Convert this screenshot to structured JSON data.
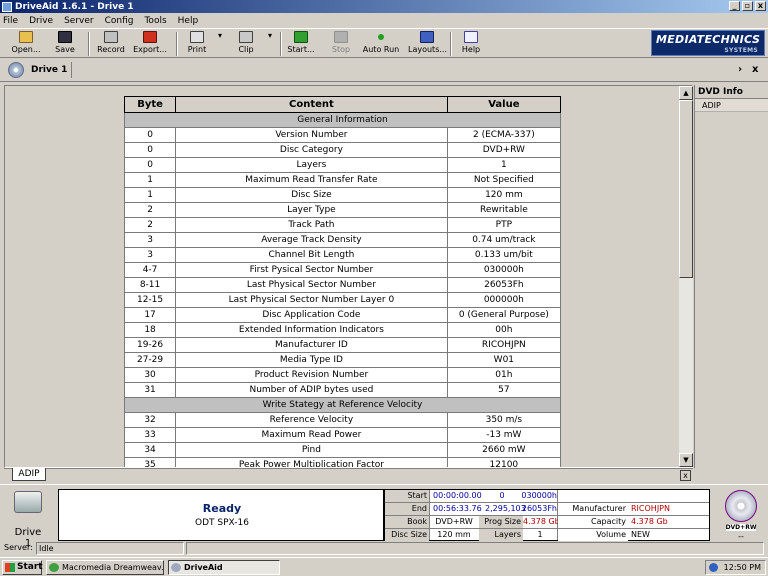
{
  "window": {
    "title": "DriveAid 1.6.1 - Drive 1",
    "minimize": "_",
    "restore": "▫",
    "close": "x"
  },
  "menu": [
    "File",
    "Drive",
    "Server",
    "Config",
    "Tools",
    "Help"
  ],
  "toolbar": {
    "open": "Open...",
    "save": "Save",
    "record": "Record",
    "export": "Export...",
    "print": "Print",
    "clip": "Clip",
    "start": "Start...",
    "stop": "Stop",
    "autorun": "Auto Run",
    "layouts": "Layouts...",
    "help": "Help",
    "dropdown_arrow": "▾"
  },
  "logo": {
    "main": "MEDIATECHNICS",
    "sub": "SYSTEMS"
  },
  "doctab": {
    "label": "Drive 1",
    "next": "›",
    "close": "x"
  },
  "table": {
    "headers": [
      "Byte",
      "Content",
      "Value"
    ],
    "rows": [
      {
        "section": "General Information"
      },
      {
        "byte": "0",
        "content": "Version Number",
        "value": "2 (ECMA-337)"
      },
      {
        "byte": "0",
        "content": "Disc Category",
        "value": "DVD+RW"
      },
      {
        "byte": "0",
        "content": "Layers",
        "value": "1"
      },
      {
        "byte": "1",
        "content": "Maximum Read Transfer Rate",
        "value": "Not Specified"
      },
      {
        "byte": "1",
        "content": "Disc Size",
        "value": "120 mm"
      },
      {
        "byte": "2",
        "content": "Layer Type",
        "value": "Rewritable"
      },
      {
        "byte": "2",
        "content": "Track Path",
        "value": "PTP"
      },
      {
        "byte": "3",
        "content": "Average Track Density",
        "value": "0.74 um/track"
      },
      {
        "byte": "3",
        "content": "Channel Bit Length",
        "value": "0.133 um/bit"
      },
      {
        "byte": "4-7",
        "content": "First Pysical Sector Number",
        "value": "030000h"
      },
      {
        "byte": "8-11",
        "content": "Last Physical Sector Number",
        "value": "26053Fh"
      },
      {
        "byte": "12-15",
        "content": "Last Physical Sector Number Layer 0",
        "value": "000000h"
      },
      {
        "byte": "17",
        "content": "Disc Application Code",
        "value": "0 (General Purpose)"
      },
      {
        "byte": "18",
        "content": "Extended Information Indicators",
        "value": "00h"
      },
      {
        "byte": "19-26",
        "content": "Manufacturer ID",
        "value": "RICOHJPN"
      },
      {
        "byte": "27-29",
        "content": "Media Type ID",
        "value": "W01"
      },
      {
        "byte": "30",
        "content": "Product Revision Number",
        "value": "01h"
      },
      {
        "byte": "31",
        "content": "Number of ADIP bytes used",
        "value": "57"
      },
      {
        "section": "Write Stategy at Reference Velocity"
      },
      {
        "byte": "32",
        "content": "Reference Velocity",
        "value": "350 m/s"
      },
      {
        "byte": "33",
        "content": "Maximum Read Power",
        "value": "-13 mW"
      },
      {
        "byte": "34",
        "content": "Pind",
        "value": "2660 mW"
      },
      {
        "byte": "35",
        "content": "Peak Power Multiplication Factor",
        "value": "12100"
      }
    ]
  },
  "sidepanel": {
    "header": "DVD Info",
    "items": [
      "ADIP"
    ]
  },
  "scroll": {
    "up": "▲",
    "down": "▼"
  },
  "tabstrip": {
    "tab": "ADIP",
    "close": "x"
  },
  "status": {
    "drive_label": "Drive 1",
    "ready": "Ready",
    "device": "ODT SPX-16",
    "start_label": "Start",
    "start_time": "00:00:00.00",
    "start_num": "0",
    "start_hex": "030000h",
    "end_label": "End",
    "end_time": "00:56:33.76",
    "end_num": "2,295,103",
    "end_hex": "26053Fh",
    "book_label": "Book",
    "book_value": "DVD+RW",
    "progsize_label": "Prog Size",
    "progsize_value": "4.378 Gb",
    "discsize_label": "Disc Size",
    "discsize_value": "120 mm",
    "layers_label": "Layers",
    "layers_value": "1",
    "manufacturer_label": "Manufacturer",
    "manufacturer_value": "RICOHJPN",
    "capacity_label": "Capacity",
    "capacity_value": "4.378 Gb",
    "volume_label": "Volume",
    "volume_value": "NEW",
    "disc_badge": "DVD+RW",
    "disc_sub": "--"
  },
  "server": {
    "label": "Server:",
    "value": "Idle"
  },
  "taskbar": {
    "start": "Start",
    "tasks": [
      "Macromedia Dreamweav...",
      "DriveAid"
    ],
    "clock": "12:50 PM"
  },
  "colors": {
    "title_start": "#0a246a",
    "title_end": "#a6caf0",
    "ready_text": "#0a246a",
    "blue_value": "#0000a0",
    "red_value": "#b00000"
  }
}
